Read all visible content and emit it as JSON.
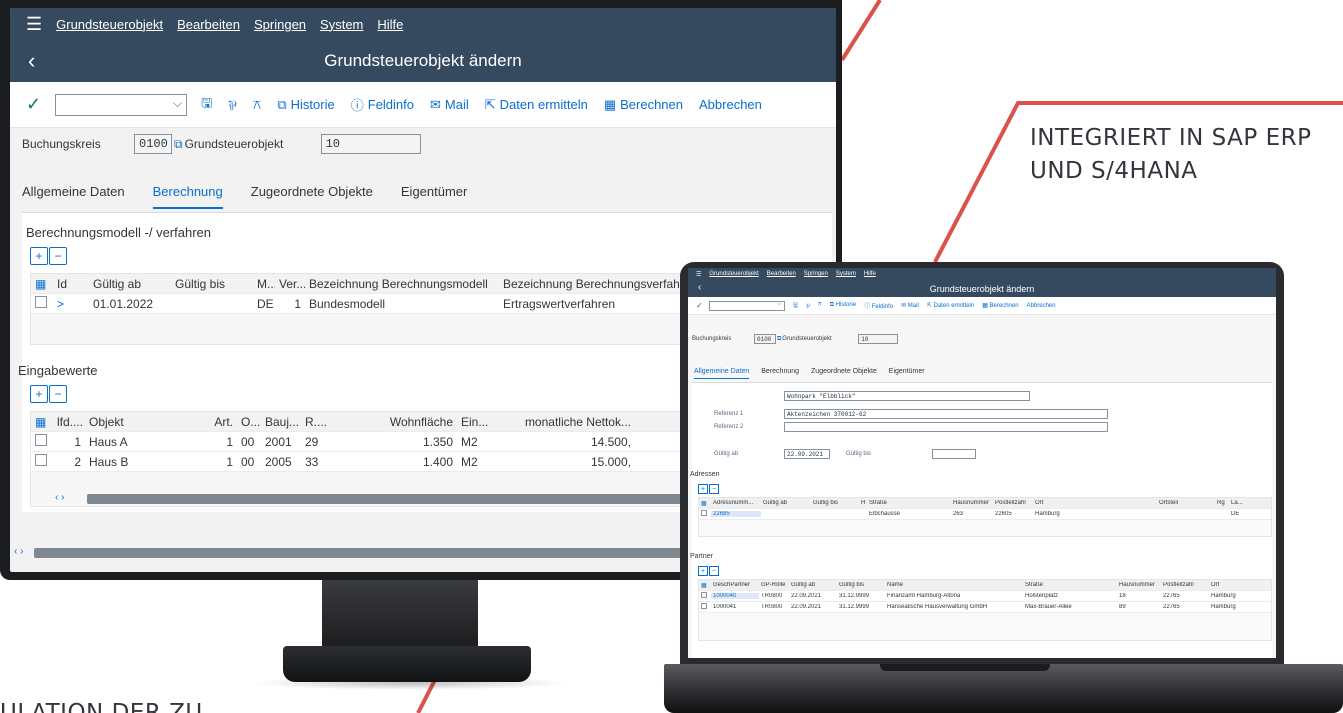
{
  "captions": {
    "right_line1": "INTEGRIERT IN SAP ERP",
    "right_line2": "UND S/4HANA",
    "bottom": "ULATION DER ZU"
  },
  "colors": {
    "shell": "#354a5f",
    "accent": "#0a6ed1",
    "decor_line": "#d9534a"
  },
  "monitor": {
    "menu": [
      "Grundsteuerobjekt",
      "Bearbeiten",
      "Springen",
      "System",
      "Hilfe"
    ],
    "title": "Grundsteuerobjekt ändern",
    "toolbar": {
      "historie": "Historie",
      "feldinfo": "Feldinfo",
      "mail": "Mail",
      "daten_ermitteln": "Daten ermitteln",
      "berechnen": "Berechnen",
      "abbrechen": "Abbrechen"
    },
    "header": {
      "buchungskreis_label": "Buchungskreis",
      "buchungskreis_value": "0100",
      "objekt_label": "Grundsteuerobjekt",
      "objekt_value": "10"
    },
    "tabs": [
      "Allgemeine Daten",
      "Berechnung",
      "Zugeordnete Objekte",
      "Eigentümer"
    ],
    "active_tab": "Berechnung",
    "modell": {
      "title": "Berechnungsmodell -/ verfahren",
      "columns": [
        "Id",
        "Gültig ab",
        "Gültig bis",
        "M...",
        "Ver...",
        "Bezeichnung Berechnungsmodell",
        "Bezeichnung Berechnungsverfahren"
      ],
      "rows": [
        {
          "id": ">",
          "gueltig_ab": "01.01.2022",
          "gueltig_bis": "",
          "m": "DE",
          "ver": "1",
          "modell": "Bundesmodell",
          "verfahren": "Ertragswertverfahren"
        }
      ]
    },
    "eingabewerte": {
      "title": "Eingabewerte",
      "columns": [
        "lfd....",
        "Objekt",
        "Art.",
        "O...",
        "Bauj...",
        "R....",
        "Wohnfläche",
        "Ein...",
        "monatliche Nettok..."
      ],
      "rows": [
        {
          "lfd": "1",
          "objekt": "Haus A",
          "art": "1",
          "o": "00",
          "bauj": "2001",
          "r": "29",
          "wohnflaeche": "1.350",
          "ein": "M2",
          "netto": "14.500,"
        },
        {
          "lfd": "2",
          "objekt": "Haus B",
          "art": "1",
          "o": "00",
          "bauj": "2005",
          "r": "33",
          "wohnflaeche": "1.400",
          "ein": "M2",
          "netto": "15.000,"
        }
      ]
    }
  },
  "laptop": {
    "menu": [
      "Grundsteuerobjekt",
      "Bearbeiten",
      "Springen",
      "System",
      "Hilfe"
    ],
    "title": "Grundsteuerobjekt ändern",
    "toolbar": {
      "historie": "Historie",
      "feldinfo": "Feldinfo",
      "mail": "Mail",
      "daten_ermitteln": "Daten ermitteln",
      "berechnen": "Berechnen",
      "abbrechen": "Abbrechen"
    },
    "header": {
      "buchungskreis_label": "Buchungskreis",
      "buchungskreis_value": "0100",
      "objekt_label": "Grundsteuerobjekt",
      "objekt_value": "10"
    },
    "tabs": [
      "Allgemeine Daten",
      "Berechnung",
      "Zugeordnete Objekte",
      "Eigentümer"
    ],
    "active_tab": "Allgemeine Daten",
    "general": {
      "name": "Wohnpark \"Elbblick\"",
      "referenz1_label": "Referenz 1",
      "referenz1_value": "Aktenzeichen 370012-62",
      "referenz2_label": "Referenz 2",
      "referenz2_value": "",
      "gueltig_ab_label": "Gültig ab",
      "gueltig_ab_value": "22.09.2021",
      "gueltig_bis_label": "Gültig bis",
      "gueltig_bis_value": ""
    },
    "adressen": {
      "title": "Adressen",
      "columns": [
        "Adressnumm...",
        "Gültig ab",
        "Gültig bis",
        "H",
        "Straße",
        "Hausnummer",
        "Postleitzahl",
        "Ort",
        "Ortsteil",
        "Rg",
        "La..."
      ],
      "rows": [
        {
          "nr": "22685",
          "ab": "",
          "bis": "",
          "h": "",
          "strasse": "Elbchausse",
          "hausnr": "263",
          "plz": "22605",
          "ort": "Hamburg",
          "ortsteil": "",
          "rg": "",
          "la": "DE"
        }
      ]
    },
    "partner": {
      "title": "Partner",
      "columns": [
        "GeschPartner",
        "GP-Rolle",
        "Gültig ab",
        "Gültig bis",
        "Name",
        "Straße",
        "Hausnummer",
        "Postleitzahl",
        "Ort"
      ],
      "rows": [
        {
          "gp": "1000040",
          "rolle": "TR0800",
          "ab": "22.09.2021",
          "bis": "31.12.9999",
          "name": "Finanzamt Hamburg-Altona",
          "strasse": "Holstenplatz",
          "hausnr": "18",
          "plz": "22765",
          "ort": "Hamburg"
        },
        {
          "gp": "1000041",
          "rolle": "TR0800",
          "ab": "22.09.2021",
          "bis": "31.12.9999",
          "name": "Hanseatische Hausverwaltung GmbH",
          "strasse": "Max-Brauer-Allee",
          "hausnr": "89",
          "plz": "22765",
          "ort": "Hamburg"
        }
      ]
    }
  }
}
